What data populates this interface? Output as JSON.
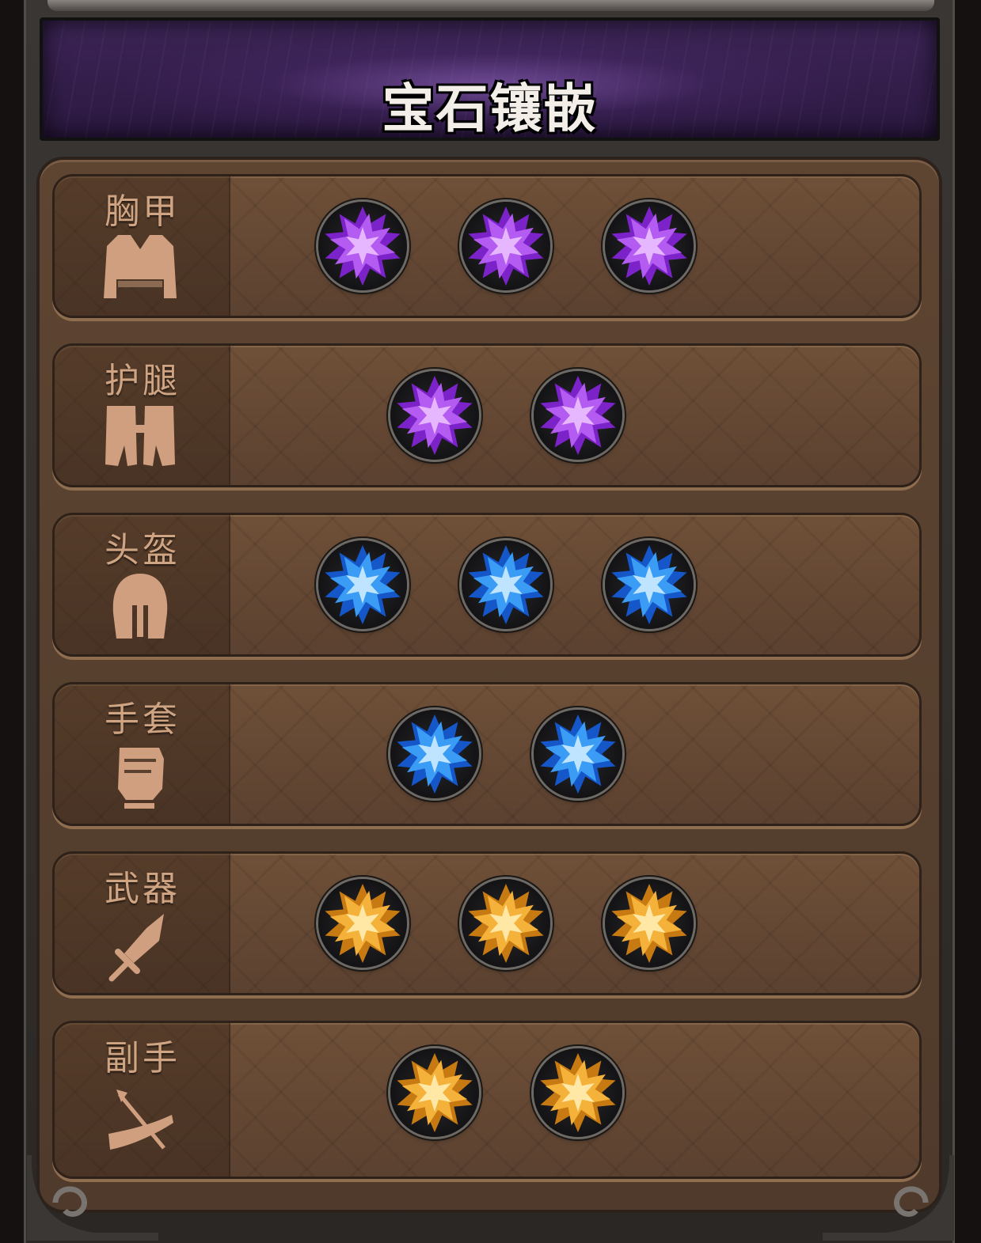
{
  "header": {
    "title": "宝石镶嵌"
  },
  "colors": {
    "purple": "#b45cf2",
    "blue": "#3a9cf5",
    "gold": "#f5b23a"
  },
  "slots": [
    {
      "name": "胸甲",
      "icon": "chest-armor-icon",
      "gem_color": "purple",
      "gem_count": 3
    },
    {
      "name": "护腿",
      "icon": "leg-armor-icon",
      "gem_color": "purple",
      "gem_count": 2
    },
    {
      "name": "头盔",
      "icon": "helmet-icon",
      "gem_color": "blue",
      "gem_count": 3
    },
    {
      "name": "手套",
      "icon": "gauntlet-fist-icon",
      "gem_color": "blue",
      "gem_count": 2
    },
    {
      "name": "武器",
      "icon": "sword-icon",
      "gem_color": "gold",
      "gem_count": 3
    },
    {
      "name": "副手",
      "icon": "horn-arrow-icon",
      "gem_color": "gold",
      "gem_count": 2
    }
  ]
}
